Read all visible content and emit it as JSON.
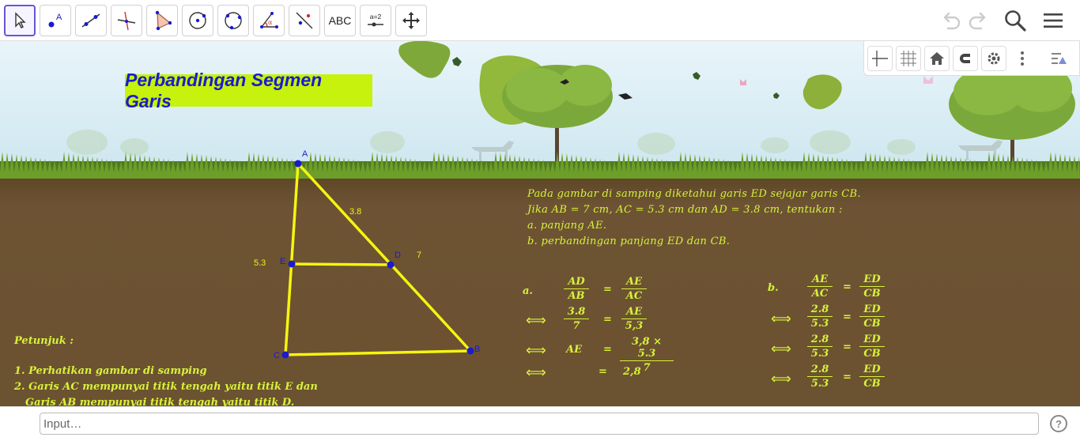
{
  "toolbar": {
    "tools": [
      {
        "name": "move-tool",
        "label": ""
      },
      {
        "name": "point-tool",
        "label": "A"
      },
      {
        "name": "line-tool",
        "label": ""
      },
      {
        "name": "perpendicular-line-tool",
        "label": ""
      },
      {
        "name": "polygon-tool",
        "label": ""
      },
      {
        "name": "circle-center-point-tool",
        "label": ""
      },
      {
        "name": "circle-three-points-tool",
        "label": ""
      },
      {
        "name": "angle-tool",
        "label": "α"
      },
      {
        "name": "reflect-about-line-tool",
        "label": ""
      },
      {
        "name": "text-tool",
        "label": "ABC"
      },
      {
        "name": "slider-tool",
        "label": "a=2"
      },
      {
        "name": "move-graphics-view-tool",
        "label": ""
      }
    ]
  },
  "worksheet": {
    "title": "Perbandingan Segmen Garis",
    "problem": {
      "line1": "Pada gambar di samping diketahui garis ED sejajar garis CB.",
      "line2": "Jika AB =  7 cm,  AC = 5.3 cm dan AD = 3.8 cm,  tentukan :",
      "line3": "a. panjang AE.",
      "line4": "b. perbandingan panjang ED dan CB."
    },
    "hint": {
      "heading": "Petunjuk :",
      "step1": "1. Perhatikan gambar di samping",
      "step2a": "2. Garis AC mempunyai titik tengah yaitu titik E dan",
      "step2b": "Garis AB mempunyai titik tengah yaitu titik D."
    },
    "points": {
      "A": "A",
      "B": "B",
      "C": "C",
      "D": "D",
      "E": "E"
    },
    "lengths": {
      "AD": "3.8",
      "DB": "7",
      "AE": "5.3"
    },
    "solution_a": {
      "label": "a.",
      "row1": {
        "lhs_num": "AD",
        "lhs_den": "AB",
        "eq": "=",
        "rhs_num": "AE",
        "rhs_den": "AC"
      },
      "row2": {
        "arrow": "⟺",
        "lhs_num": "3.8",
        "lhs_den": "7",
        "eq": "=",
        "rhs_num": "AE",
        "rhs_den": "5,3"
      },
      "row3": {
        "arrow": "⟺",
        "lhs": "AE",
        "eq": "=",
        "rhs_num": "3,8 × 5.3",
        "rhs_den": "7"
      },
      "row4": {
        "arrow": "⟺",
        "eq": "=",
        "rhs": "2,8"
      }
    },
    "solution_b": {
      "label": "b.",
      "row1": {
        "lhs_num": "AE",
        "lhs_den": "AC",
        "eq": "=",
        "rhs_num": "ED",
        "rhs_den": "CB"
      },
      "row2": {
        "arrow": "⟺",
        "lhs_num": "2.8",
        "lhs_den": "5.3",
        "eq": "=",
        "rhs_num": "ED",
        "rhs_den": "CB"
      },
      "row3": {
        "arrow": "⟺",
        "lhs_num": "2.8",
        "lhs_den": "5.3",
        "eq": "=",
        "rhs_num": "ED",
        "rhs_den": "CB"
      },
      "row4": {
        "arrow": "⟺",
        "lhs_num": "2.8",
        "lhs_den": "5.3",
        "eq": "=",
        "rhs_num": "ED",
        "rhs_den": "CB"
      }
    }
  },
  "input_bar": {
    "placeholder": "Input…",
    "help": "?"
  },
  "colors": {
    "title_bg": "#c6f20e",
    "title_text": "#1a1ad0",
    "triangle": "#f5f510",
    "point": "#1a1ad0",
    "math_text": "#d8f23a",
    "soil": "#6b5230",
    "sky": "#dff0f6",
    "active_tool": "#6557d2"
  }
}
